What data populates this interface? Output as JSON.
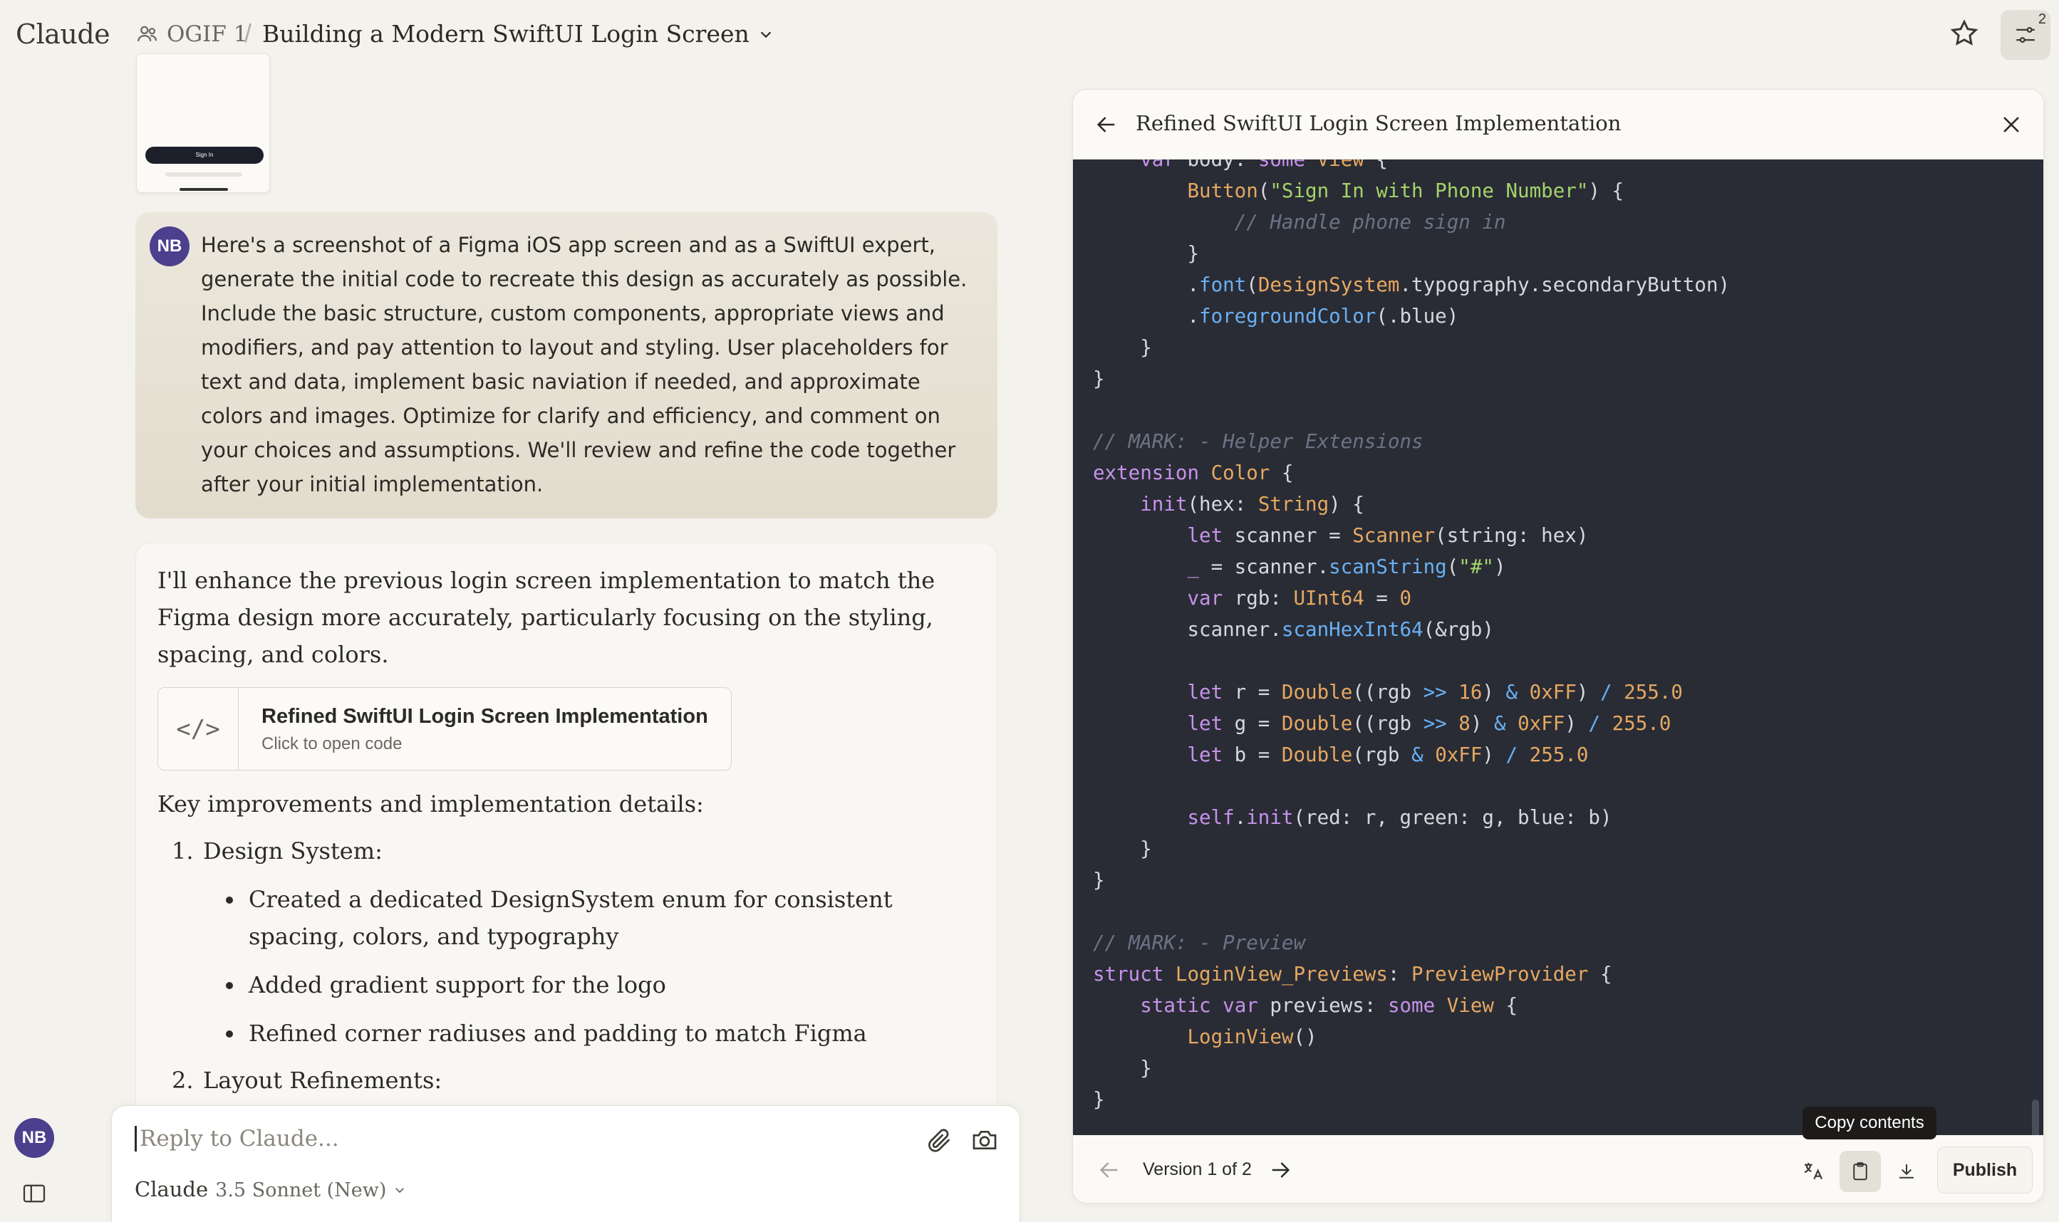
{
  "app": {
    "brand": "Claude"
  },
  "header": {
    "project": "OGIF 1",
    "separator": "/",
    "chat_title": "Building a Modern SwiftUI Login Screen",
    "icons": {
      "project": "people-icon",
      "star": "star-icon",
      "settings": "sliders-icon"
    },
    "settings_badge": "2"
  },
  "thumbnail": {
    "button_text": "Sign In"
  },
  "user_message": {
    "avatar": "NB",
    "text": "Here's a screenshot of a Figma iOS app screen and as a SwiftUI expert, generate the initial code to recreate this design as accurately as possible. Include the basic structure, custom components, appropriate views and modifiers, and pay attention to layout and styling. User placeholders for text and data, implement basic naviation if needed, and approximate colors and images. Optimize for clarify and efficiency, and comment on your choices and assumptions. We'll review and refine the code together after your initial implementation."
  },
  "assistant_message": {
    "intro": "I'll enhance the previous login screen implementation to match the Figma design more accurately, particularly focusing on the styling, spacing, and colors.",
    "artifact": {
      "icon": "code-icon",
      "icon_glyph": "</>",
      "title": "Refined SwiftUI Login Screen Implementation",
      "subtitle": "Click to open code"
    },
    "details_heading": "Key improvements and implementation details:",
    "sections": [
      {
        "number": "1.",
        "title": "Design System:",
        "bullets": [
          "Created a dedicated DesignSystem enum for consistent spacing, colors, and typography",
          "Added gradient support for the logo",
          "Refined corner radiuses and padding to match Figma"
        ]
      },
      {
        "number": "2.",
        "title": "Layout Refinements:"
      }
    ]
  },
  "composer": {
    "placeholder": "Reply to Claude...",
    "model_name": "Claude",
    "model_version": "3.5 Sonnet (New)",
    "icons": {
      "attach": "paperclip-icon",
      "camera": "camera-icon"
    }
  },
  "sidebar": {
    "avatar": "NB"
  },
  "artifact_panel": {
    "title": "Refined SwiftUI Login Screen Implementation",
    "footer": {
      "version_label": "Version 1 of 2",
      "publish_label": "Publish",
      "tooltip": "Copy contents"
    },
    "code_lines": [
      "    var body: some View {",
      "        Button(\"Sign In with Phone Number\") {",
      "            // Handle phone sign in",
      "        }",
      "        .font(DesignSystem.typography.secondaryButton)",
      "        .foregroundColor(.blue)",
      "    }",
      "}",
      "",
      "// MARK: - Helper Extensions",
      "extension Color {",
      "    init(hex: String) {",
      "        let scanner = Scanner(string: hex)",
      "        _ = scanner.scanString(\"#\")",
      "        var rgb: UInt64 = 0",
      "        scanner.scanHexInt64(&rgb)",
      "",
      "        let r = Double((rgb >> 16) & 0xFF) / 255.0",
      "        let g = Double((rgb >> 8) & 0xFF) / 255.0",
      "        let b = Double(rgb & 0xFF) / 255.0",
      "",
      "        self.init(red: r, green: g, blue: b)",
      "    }",
      "}",
      "",
      "// MARK: - Preview",
      "struct LoginView_Previews: PreviewProvider {",
      "    static var previews: some View {",
      "        LoginView()",
      "    }",
      "}"
    ]
  },
  "colors": {
    "background": "#f4f2ec",
    "user_bubble": "#e6e1d4",
    "avatar": "#4b3f8e",
    "code_background": "#292c35",
    "keyword": "#c792ea",
    "type": "#e6a861",
    "function": "#6ab0f3",
    "string": "#a5d36a",
    "comment": "#6b7385"
  }
}
